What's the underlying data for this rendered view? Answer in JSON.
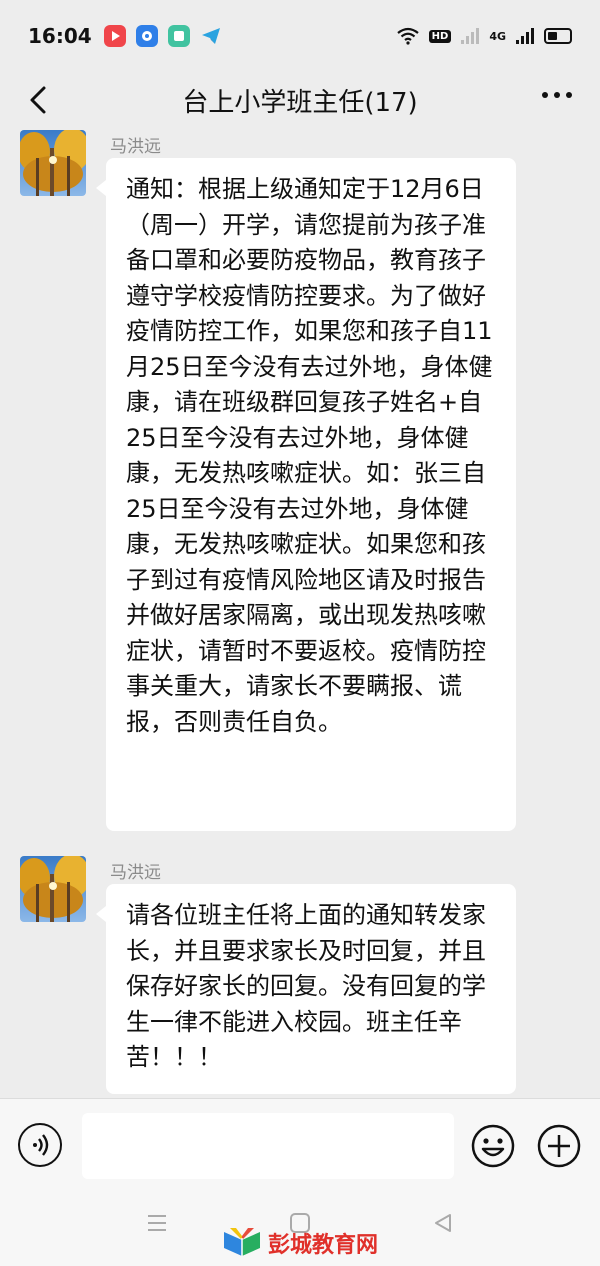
{
  "status_bar": {
    "time": "16:04",
    "hd_label": "HD",
    "network": "4G",
    "app_icons": [
      "red-play-app-icon",
      "blue-circle-app-icon",
      "green-square-app-icon",
      "telegram-app-icon"
    ]
  },
  "chat": {
    "title": "台上小学班主任(17)"
  },
  "messages": [
    {
      "sender": "马洪远",
      "text": "通知：根据上级通知定于12月6日（周一）开学，请您提前为孩子准备口罩和必要防疫物品，教育孩子遵守学校疫情防控要求。为了做好疫情防控工作，如果您和孩子自11月25日至今没有去过外地，身体健康，请在班级群回复孩子姓名+自25日至今没有去过外地，身体健康，无发热咳嗽症状。如：张三自25日至今没有去过外地，身体健康，无发热咳嗽症状。如果您和孩子到过有疫情风险地区请及时报告并做好居家隔离，或出现发热咳嗽症状，请暂时不要返校。疫情防控事关重大，请家长不要瞒报、谎报，否则责任自负。"
    },
    {
      "sender": "马洪远",
      "text": "请各位班主任将上面的通知转发家长，并且要求家长及时回复，并且保存好家长的回复。没有回复的学生一律不能进入校园。班主任辛苦！！！"
    }
  ],
  "input": {
    "value": ""
  },
  "watermark": {
    "text": "彭城教育网"
  }
}
